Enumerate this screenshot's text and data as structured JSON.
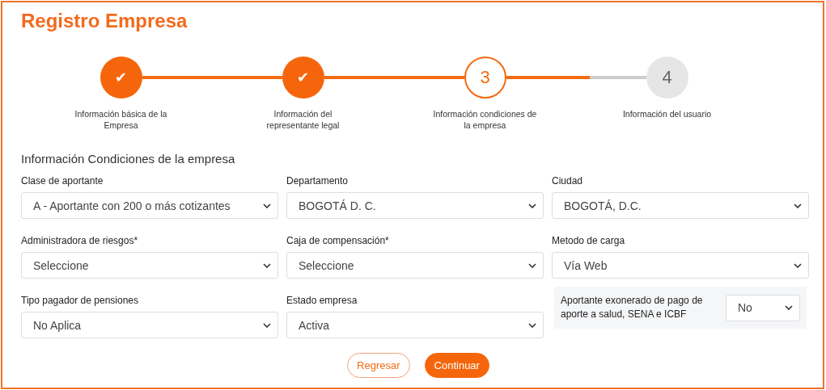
{
  "title": "Registro Empresa",
  "steps": [
    {
      "marker": "✔",
      "label": "Información básica de la Empresa",
      "completed": true,
      "selected": false
    },
    {
      "marker": "✔",
      "label": "Información del representante legal",
      "completed": true,
      "selected": false
    },
    {
      "marker": "3",
      "label": "Información condiciones de la empresa",
      "completed": false,
      "selected": true
    },
    {
      "marker": "4",
      "label": "Información del usuario",
      "completed": false,
      "selected": false
    }
  ],
  "connectors": [
    {
      "level": 1
    },
    {
      "level": 1
    },
    {
      "level": 0.6
    }
  ],
  "section_title": "Información Condiciones de la empresa",
  "fields": [
    {
      "kind": "select",
      "label": "Clase de aportante",
      "value": "A - Aportante con 200 o más cotizantes"
    },
    {
      "kind": "select",
      "label": "Departamento",
      "value": "BOGOTÁ D. C."
    },
    {
      "kind": "select",
      "label": "Ciudad",
      "value": "BOGOTÁ, D.C."
    },
    {
      "kind": "select",
      "label": "Administradora de riesgos*",
      "value": "Seleccione"
    },
    {
      "kind": "select",
      "label": "Caja de compensación*",
      "value": "Seleccione"
    },
    {
      "kind": "select",
      "label": "Metodo de carga",
      "value": "Vía Web"
    },
    {
      "kind": "select",
      "label": "Tipo pagador de pensiones",
      "value": "No Aplica"
    },
    {
      "kind": "select",
      "label": "Estado empresa",
      "value": "Activa"
    },
    {
      "kind": "inline",
      "label": "Aportante exonerado de pago de aporte a salud, SENA e ICBF",
      "value": "No"
    }
  ],
  "buttons": [
    {
      "kind": "outline",
      "label": "Regresar"
    },
    {
      "kind": "primary",
      "label": "Continuar"
    }
  ]
}
